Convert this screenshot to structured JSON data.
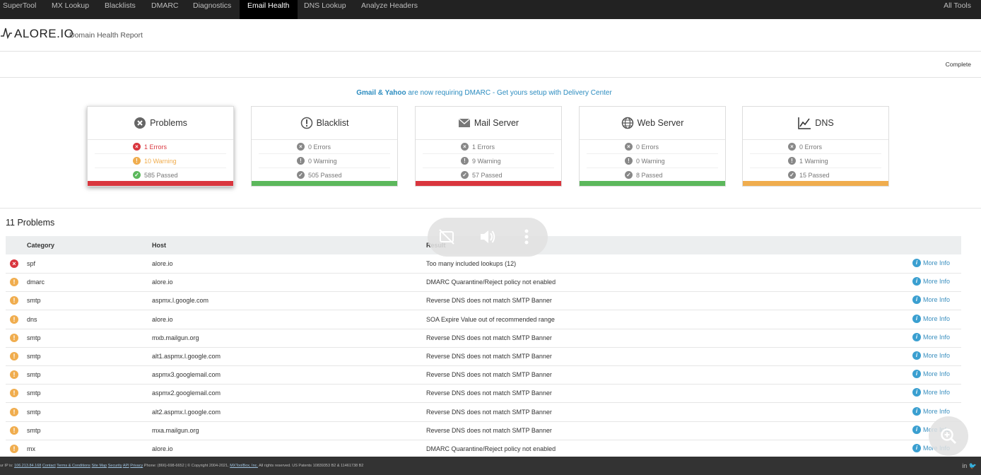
{
  "nav": {
    "items": [
      "SuperTool",
      "MX Lookup",
      "Blacklists",
      "DMARC",
      "Diagnostics",
      "Email Health",
      "DNS Lookup",
      "Analyze Headers"
    ],
    "active": "Email Health",
    "all_tools": "All Tools"
  },
  "header": {
    "logo": "ALORE.IO",
    "subtitle": "Domain Health Report",
    "status": "Complete"
  },
  "announcement": {
    "bold": "Gmail & Yahoo",
    "rest": " are now requiring DMARC - Get yours setup with Delivery Center"
  },
  "cards": [
    {
      "title": "Problems",
      "icon": "x-circle-icon",
      "errors": "1 Errors",
      "warnings": "10 Warning",
      "passed": "585 Passed",
      "bar_color": "#d9363e"
    },
    {
      "title": "Blacklist",
      "icon": "exclamation-circle-icon",
      "errors": "0 Errors",
      "warnings": "0 Warning",
      "passed": "505 Passed",
      "bar_color": "#5cb85c"
    },
    {
      "title": "Mail Server",
      "icon": "envelope-icon",
      "errors": "1 Errors",
      "warnings": "9 Warning",
      "passed": "57 Passed",
      "bar_color": "#d9363e"
    },
    {
      "title": "Web Server",
      "icon": "globe-icon",
      "errors": "0 Errors",
      "warnings": "0 Warning",
      "passed": "8 Passed",
      "bar_color": "#5cb85c"
    },
    {
      "title": "DNS",
      "icon": "chart-icon",
      "errors": "0 Errors",
      "warnings": "1 Warning",
      "passed": "15 Passed",
      "bar_color": "#f0ad4e"
    }
  ],
  "problems": {
    "title": "11 Problems",
    "columns": [
      "Category",
      "Host",
      "Result"
    ],
    "more_info": "More Info",
    "rows": [
      {
        "status": "error",
        "category": "spf",
        "host": "alore.io",
        "result": "Too many included lookups (12)"
      },
      {
        "status": "warning",
        "category": "dmarc",
        "host": "alore.io",
        "result": "DMARC Quarantine/Reject policy not enabled"
      },
      {
        "status": "warning",
        "category": "smtp",
        "host": "aspmx.l.google.com",
        "result": "Reverse DNS does not match SMTP Banner"
      },
      {
        "status": "warning",
        "category": "dns",
        "host": "alore.io",
        "result": "SOA Expire Value out of recommended range"
      },
      {
        "status": "warning",
        "category": "smtp",
        "host": "mxb.mailgun.org",
        "result": "Reverse DNS does not match SMTP Banner"
      },
      {
        "status": "warning",
        "category": "smtp",
        "host": "alt1.aspmx.l.google.com",
        "result": "Reverse DNS does not match SMTP Banner"
      },
      {
        "status": "warning",
        "category": "smtp",
        "host": "aspmx3.googlemail.com",
        "result": "Reverse DNS does not match SMTP Banner"
      },
      {
        "status": "warning",
        "category": "smtp",
        "host": "aspmx2.googlemail.com",
        "result": "Reverse DNS does not match SMTP Banner"
      },
      {
        "status": "warning",
        "category": "smtp",
        "host": "alt2.aspmx.l.google.com",
        "result": "Reverse DNS does not match SMTP Banner"
      },
      {
        "status": "warning",
        "category": "smtp",
        "host": "mxa.mailgun.org",
        "result": "Reverse DNS does not match SMTP Banner"
      },
      {
        "status": "warning",
        "category": "mx",
        "host": "alore.io",
        "result": "DMARC Quarantine/Reject policy not enabled"
      }
    ]
  },
  "footer": {
    "text_prefix": "ur IP is: ",
    "ip": "106.213.84.168",
    "links": [
      "Contact",
      "Terms & Conditions",
      "Site Map",
      "Security",
      "API",
      "Privacy"
    ],
    "phone": "Phone: (866)-698-6652",
    "copyright": "© Copyright 2004-2021, ",
    "company": "MXToolBox, Inc.",
    "rights": " All rights reserved. US Patents 10839353 B2 & 11461738 B2"
  },
  "colors": {
    "error": "#d9363e",
    "warning": "#f0ad4e",
    "passed": "#5cb85c",
    "neutral": "#888888",
    "link": "#3a8fbf"
  }
}
